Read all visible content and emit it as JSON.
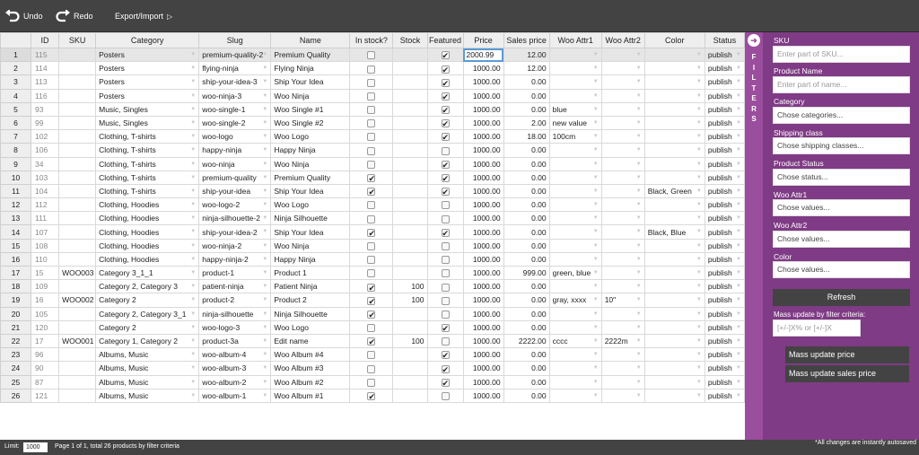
{
  "toolbar": {
    "undo_label": "Undo",
    "redo_label": "Redo",
    "export_label": "Export/Import",
    "export_arrow": "▷"
  },
  "grid": {
    "columns": [
      "",
      "ID",
      "SKU",
      "Category",
      "Slug",
      "Name",
      "In stock?",
      "Stock",
      "Featured",
      "Price",
      "Sales price",
      "Woo Attr1",
      "Woo Attr2",
      "Color",
      "Status"
    ],
    "editing_value": "2000.99",
    "rows": [
      {
        "n": "1",
        "id": "115",
        "sku": "",
        "category": "Posters",
        "slug": "premium-quality-2",
        "name": "Premium Quality",
        "instock": false,
        "stock": "",
        "featured": true,
        "price": "2000.99",
        "sales": "12.00",
        "attr1": "",
        "attr2": "",
        "color": "",
        "status": "publish"
      },
      {
        "n": "2",
        "id": "114",
        "sku": "",
        "category": "Posters",
        "slug": "flying-ninja",
        "name": "Flying Ninja",
        "instock": false,
        "stock": "",
        "featured": true,
        "price": "1000.00",
        "sales": "12.00",
        "attr1": "",
        "attr2": "",
        "color": "",
        "status": "publish"
      },
      {
        "n": "3",
        "id": "113",
        "sku": "",
        "category": "Posters",
        "slug": "ship-your-idea-3",
        "name": "Ship Your Idea",
        "instock": false,
        "stock": "",
        "featured": true,
        "price": "1000.00",
        "sales": "0.00",
        "attr1": "",
        "attr2": "",
        "color": "",
        "status": "publish"
      },
      {
        "n": "4",
        "id": "116",
        "sku": "",
        "category": "Posters",
        "slug": "woo-ninja-3",
        "name": "Woo Ninja",
        "instock": false,
        "stock": "",
        "featured": true,
        "price": "1000.00",
        "sales": "0.00",
        "attr1": "",
        "attr2": "",
        "color": "",
        "status": "publish"
      },
      {
        "n": "5",
        "id": "93",
        "sku": "",
        "category": "Music, Singles",
        "slug": "woo-single-1",
        "name": "Woo Single #1",
        "instock": false,
        "stock": "",
        "featured": true,
        "price": "1000.00",
        "sales": "0.00",
        "attr1": "blue",
        "attr2": "",
        "color": "",
        "status": "publish"
      },
      {
        "n": "6",
        "id": "99",
        "sku": "",
        "category": "Music, Singles",
        "slug": "woo-single-2",
        "name": "Woo Single #2",
        "instock": false,
        "stock": "",
        "featured": true,
        "price": "1000.00",
        "sales": "2.00",
        "attr1": "new value",
        "attr2": "",
        "color": "",
        "status": "publish"
      },
      {
        "n": "7",
        "id": "102",
        "sku": "",
        "category": "Clothing, T-shirts",
        "slug": "woo-logo",
        "name": "Woo Logo",
        "instock": false,
        "stock": "",
        "featured": true,
        "price": "1000.00",
        "sales": "18.00",
        "attr1": "100cm",
        "attr2": "",
        "color": "",
        "status": "publish"
      },
      {
        "n": "8",
        "id": "106",
        "sku": "",
        "category": "Clothing, T-shirts",
        "slug": "happy-ninja",
        "name": "Happy Ninja",
        "instock": false,
        "stock": "",
        "featured": false,
        "price": "1000.00",
        "sales": "0.00",
        "attr1": "",
        "attr2": "",
        "color": "",
        "status": "publish"
      },
      {
        "n": "9",
        "id": "34",
        "sku": "",
        "category": "Clothing, T-shirts",
        "slug": "woo-ninja",
        "name": "Woo Ninja",
        "instock": false,
        "stock": "",
        "featured": true,
        "price": "1000.00",
        "sales": "0.00",
        "attr1": "",
        "attr2": "",
        "color": "",
        "status": "publish"
      },
      {
        "n": "10",
        "id": "103",
        "sku": "",
        "category": "Clothing, T-shirts",
        "slug": "premium-quality",
        "name": "Premium Quality",
        "instock": true,
        "stock": "",
        "featured": true,
        "price": "1000.00",
        "sales": "0.00",
        "attr1": "",
        "attr2": "",
        "color": "",
        "status": "publish"
      },
      {
        "n": "11",
        "id": "104",
        "sku": "",
        "category": "Clothing, T-shirts",
        "slug": "ship-your-idea",
        "name": "Ship Your Idea",
        "instock": true,
        "stock": "",
        "featured": true,
        "price": "1000.00",
        "sales": "0.00",
        "attr1": "",
        "attr2": "",
        "color": "Black, Green",
        "status": "publish"
      },
      {
        "n": "12",
        "id": "112",
        "sku": "",
        "category": "Clothing, Hoodies",
        "slug": "woo-logo-2",
        "name": "Woo Logo",
        "instock": false,
        "stock": "",
        "featured": false,
        "price": "1000.00",
        "sales": "0.00",
        "attr1": "",
        "attr2": "",
        "color": "",
        "status": "publish"
      },
      {
        "n": "13",
        "id": "111",
        "sku": "",
        "category": "Clothing, Hoodies",
        "slug": "ninja-silhouette-2",
        "name": "Ninja Silhouette",
        "instock": false,
        "stock": "",
        "featured": false,
        "price": "1000.00",
        "sales": "0.00",
        "attr1": "",
        "attr2": "",
        "color": "",
        "status": "publish"
      },
      {
        "n": "14",
        "id": "107",
        "sku": "",
        "category": "Clothing, Hoodies",
        "slug": "ship-your-idea-2",
        "name": "Ship Your Idea",
        "instock": true,
        "stock": "",
        "featured": true,
        "price": "1000.00",
        "sales": "0.00",
        "attr1": "",
        "attr2": "",
        "color": "Black, Blue",
        "status": "publish"
      },
      {
        "n": "15",
        "id": "108",
        "sku": "",
        "category": "Clothing, Hoodies",
        "slug": "woo-ninja-2",
        "name": "Woo Ninja",
        "instock": false,
        "stock": "",
        "featured": false,
        "price": "1000.00",
        "sales": "0.00",
        "attr1": "",
        "attr2": "",
        "color": "",
        "status": "publish"
      },
      {
        "n": "16",
        "id": "110",
        "sku": "",
        "category": "Clothing, Hoodies",
        "slug": "happy-ninja-2",
        "name": "Happy Ninja",
        "instock": false,
        "stock": "",
        "featured": false,
        "price": "1000.00",
        "sales": "0.00",
        "attr1": "",
        "attr2": "",
        "color": "",
        "status": "publish"
      },
      {
        "n": "17",
        "id": "15",
        "sku": "WOO003",
        "category": "Category 3_1_1",
        "slug": "product-1",
        "name": "Product 1",
        "instock": false,
        "stock": "",
        "featured": false,
        "price": "1000.00",
        "sales": "999.00",
        "attr1": "green, blue",
        "attr2": "",
        "color": "",
        "status": "publish"
      },
      {
        "n": "18",
        "id": "109",
        "sku": "",
        "category": "Category 2, Category 3",
        "slug": "patient-ninja",
        "name": "Patient Ninja",
        "instock": true,
        "stock": "100",
        "featured": false,
        "price": "1000.00",
        "sales": "0.00",
        "attr1": "",
        "attr2": "",
        "color": "",
        "status": "publish"
      },
      {
        "n": "19",
        "id": "16",
        "sku": "WOO002",
        "category": "Category 2",
        "slug": "product-2",
        "name": "Product 2",
        "instock": true,
        "stock": "100",
        "featured": false,
        "price": "1000.00",
        "sales": "0.00",
        "attr1": "gray, xxxx",
        "attr2": "10\"",
        "color": "",
        "status": "publish"
      },
      {
        "n": "20",
        "id": "105",
        "sku": "",
        "category": "Category 2, Category 3_1",
        "slug": "ninja-silhouette",
        "name": "Ninja Silhouette",
        "instock": true,
        "stock": "",
        "featured": false,
        "price": "1000.00",
        "sales": "0.00",
        "attr1": "",
        "attr2": "",
        "color": "",
        "status": "publish"
      },
      {
        "n": "21",
        "id": "120",
        "sku": "",
        "category": "Category 2",
        "slug": "woo-logo-3",
        "name": "Woo Logo",
        "instock": false,
        "stock": "",
        "featured": true,
        "price": "1000.00",
        "sales": "0.00",
        "attr1": "",
        "attr2": "",
        "color": "",
        "status": "publish"
      },
      {
        "n": "22",
        "id": "17",
        "sku": "WOO001",
        "category": "Category 1, Category 2",
        "slug": "product-3a",
        "name": "Edit name",
        "instock": true,
        "stock": "100",
        "featured": false,
        "price": "1000.00",
        "sales": "2222.00",
        "attr1": "cccc",
        "attr2": "2222m",
        "color": "",
        "status": "publish"
      },
      {
        "n": "23",
        "id": "96",
        "sku": "",
        "category": "Albums, Music",
        "slug": "woo-album-4",
        "name": "Woo Album #4",
        "instock": false,
        "stock": "",
        "featured": true,
        "price": "1000.00",
        "sales": "0.00",
        "attr1": "",
        "attr2": "",
        "color": "",
        "status": "publish"
      },
      {
        "n": "24",
        "id": "90",
        "sku": "",
        "category": "Albums, Music",
        "slug": "woo-album-3",
        "name": "Woo Album #3",
        "instock": false,
        "stock": "",
        "featured": true,
        "price": "1000.00",
        "sales": "0.00",
        "attr1": "",
        "attr2": "",
        "color": "",
        "status": "publish"
      },
      {
        "n": "25",
        "id": "87",
        "sku": "",
        "category": "Albums, Music",
        "slug": "woo-album-2",
        "name": "Woo Album #2",
        "instock": false,
        "stock": "",
        "featured": true,
        "price": "1000.00",
        "sales": "0.00",
        "attr1": "",
        "attr2": "",
        "color": "",
        "status": "publish"
      },
      {
        "n": "26",
        "id": "121",
        "sku": "",
        "category": "Albums, Music",
        "slug": "woo-album-1",
        "name": "Woo Album #1",
        "instock": true,
        "stock": "",
        "featured": false,
        "price": "1000.00",
        "sales": "0.00",
        "attr1": "",
        "attr2": "",
        "color": "",
        "status": "publish"
      }
    ]
  },
  "filters_tab": {
    "letters": [
      "F",
      "I",
      "L",
      "T",
      "E",
      "R",
      "S"
    ],
    "icon": "circle-arrow-right-icon"
  },
  "sidebar": {
    "sku_label": "SKU",
    "sku_placeholder": "Enter part of SKU...",
    "name_label": "Product Name",
    "name_placeholder": "Enter part of name...",
    "category_label": "Category",
    "category_placeholder": "Chose categories...",
    "shipping_label": "Shipping class",
    "shipping_placeholder": "Chose shipping classes...",
    "status_label": "Product Status",
    "status_placeholder": "Chose status...",
    "attr1_label": "Woo Attr1",
    "attr1_placeholder": "Chose values...",
    "attr2_label": "Woo Attr2",
    "attr2_placeholder": "Chose values...",
    "color_label": "Color",
    "color_placeholder": "Chose values...",
    "refresh_label": "Refresh",
    "mass_label": "Mass update by filter criteria:",
    "mass_placeholder": "[+/-]X% or [+/-]X",
    "mass_price_label": "Mass update price",
    "mass_sales_label": "Mass update sales price"
  },
  "status": {
    "limit_label": "Limit:",
    "limit_value": "1000",
    "page_info": "Page 1 of 1, total 26 products by filter criteria",
    "autosave_note": "*All changes are instantly autosaved"
  },
  "colors": {
    "toolbar": "#434343",
    "sidebar": "#7f3b85",
    "filters_tab": "#9b4d9e",
    "grid_header": "#eeeeee"
  }
}
